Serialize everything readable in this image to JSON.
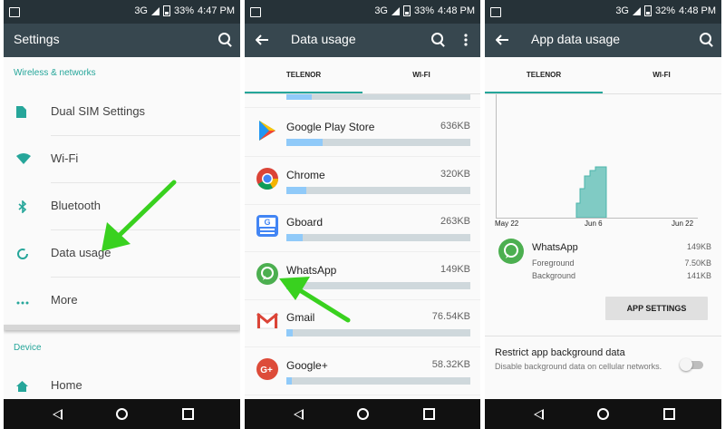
{
  "phones": [
    {
      "status": {
        "network": "3G",
        "battery": "33%",
        "time": "4:47 PM"
      },
      "title": "Settings",
      "sections": [
        {
          "header": "Wireless & networks",
          "items": [
            {
              "label": "Dual SIM Settings",
              "icon": "sim-card-icon"
            },
            {
              "label": "Wi-Fi",
              "icon": "wifi-icon"
            },
            {
              "label": "Bluetooth",
              "icon": "bluetooth-icon"
            },
            {
              "label": "Data usage",
              "icon": "data-usage-icon"
            },
            {
              "label": "More",
              "icon": "more-dots-icon"
            }
          ]
        },
        {
          "header": "Device",
          "items": [
            {
              "label": "Home",
              "icon": "home-icon"
            }
          ]
        }
      ]
    },
    {
      "status": {
        "network": "3G",
        "battery": "33%",
        "time": "4:48 PM"
      },
      "title": "Data usage",
      "tabs": [
        "TELENOR",
        "WI-FI"
      ],
      "apps": [
        {
          "name": "Google Play Store",
          "amount": "636KB",
          "fraction": 0.09,
          "icon": "play-store-icon"
        },
        {
          "name": "Chrome",
          "amount": "320KB",
          "fraction": 0.05,
          "icon": "chrome-icon"
        },
        {
          "name": "Gboard",
          "amount": "263KB",
          "fraction": 0.04,
          "icon": "gboard-icon"
        },
        {
          "name": "WhatsApp",
          "amount": "149KB",
          "fraction": 0.03,
          "icon": "whatsapp-icon"
        },
        {
          "name": "Gmail",
          "amount": "76.54KB",
          "fraction": 0.015,
          "icon": "gmail-icon"
        },
        {
          "name": "Google+",
          "amount": "58.32KB",
          "fraction": 0.012,
          "icon": "google-plus-icon"
        }
      ]
    },
    {
      "status": {
        "network": "3G",
        "battery": "32%",
        "time": "4:48 PM"
      },
      "title": "App data usage",
      "tabs": [
        "TELENOR",
        "WI-FI"
      ],
      "chart_dates": [
        "May 22",
        "Jun 6",
        "Jun 22"
      ],
      "app": {
        "name": "WhatsApp",
        "total": "149KB",
        "foreground_label": "Foreground",
        "foreground": "7.50KB",
        "background_label": "Background",
        "background": "141KB"
      },
      "app_settings_button": "APP SETTINGS",
      "restrict": {
        "title": "Restrict app background data",
        "description": "Disable background data on cellular networks.",
        "enabled": false
      }
    }
  ],
  "colors": {
    "statusbar": "#263238",
    "appbar": "#37474f",
    "accent": "#26a69a",
    "annotation": "#39d11f"
  }
}
